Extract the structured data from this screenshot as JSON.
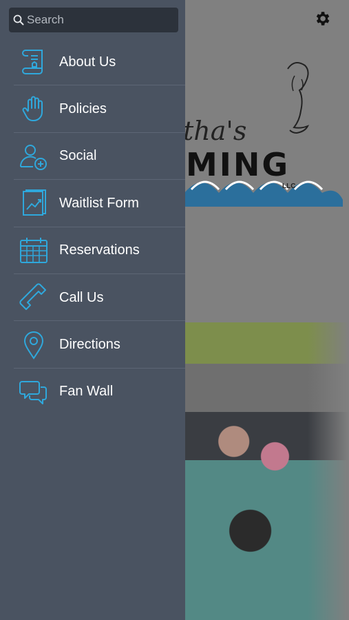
{
  "search": {
    "placeholder": "Search"
  },
  "menu": [
    {
      "label": "About Us",
      "icon": "scroll-icon"
    },
    {
      "label": "Policies",
      "icon": "hand-icon"
    },
    {
      "label": "Social",
      "icon": "add-user-icon"
    },
    {
      "label": "Waitlist Form",
      "icon": "chart-document-icon"
    },
    {
      "label": "Reservations",
      "icon": "calendar-icon"
    },
    {
      "label": "Call Us",
      "icon": "phone-icon"
    },
    {
      "label": "Directions",
      "icon": "location-pin-icon"
    },
    {
      "label": "Fan Wall",
      "icon": "chat-bubbles-icon"
    }
  ],
  "background": {
    "logo_script": "tha's",
    "logo_word": "MING",
    "logo_suffix": "LLC"
  },
  "colors": {
    "drawer_bg": "#4a5361",
    "search_bg": "#2c323b",
    "icon_accent": "#2fa8dc",
    "divider": "#5d6675",
    "dim_overlay": "#808080"
  }
}
